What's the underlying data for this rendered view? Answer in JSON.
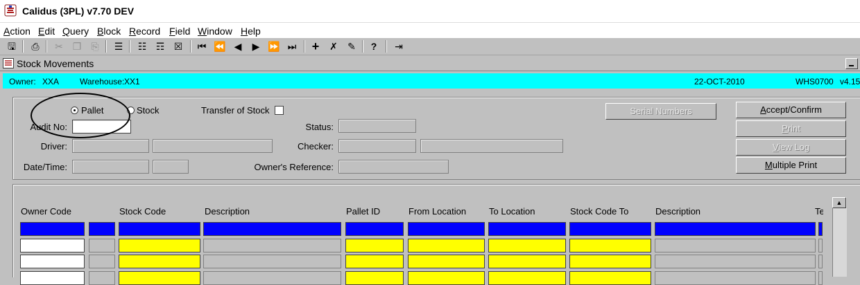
{
  "app": {
    "title": "Calidus (3PL) v7.70 DEV"
  },
  "menu": [
    {
      "label": "Action",
      "u": "A",
      "rest": "ction"
    },
    {
      "label": "Edit",
      "u": "E",
      "rest": "dit"
    },
    {
      "label": "Query",
      "u": "Q",
      "rest": "uery"
    },
    {
      "label": "Block",
      "u": "B",
      "rest": "lock"
    },
    {
      "label": "Record",
      "u": "R",
      "rest": "ecord"
    },
    {
      "label": "Field",
      "u": "F",
      "rest": "ield"
    },
    {
      "label": "Window",
      "u": "W",
      "rest": "indow"
    },
    {
      "label": "Help",
      "u": "H",
      "rest": "elp"
    }
  ],
  "window": {
    "title": "Stock Movements"
  },
  "info_bar": {
    "owner_label": "Owner:",
    "owner_value": "XXA",
    "warehouse_label": "Warehouse:",
    "warehouse_value": "XX1",
    "date": "22-OCT-2010",
    "module": "WHS0700",
    "version": "v4.15"
  },
  "form": {
    "radio_pallet": "Pallet",
    "radio_stock": "Stock",
    "radio_selected": "Pallet",
    "transfer_label": "Transfer of Stock",
    "audit_label": "Audit No:",
    "driver_label": "Driver:",
    "datetime_label": "Date/Time:",
    "status_label": "Status:",
    "checker_label": "Checker:",
    "owners_ref_label": "Owner's Reference:"
  },
  "buttons": {
    "serial_numbers": "Serial Numbers",
    "accept_confirm_u": "A",
    "accept_confirm_rest": "ccept/Confirm",
    "print_u": "P",
    "print_rest": "rint",
    "view_log_u": "V",
    "view_log_rest": "iew Log",
    "multiple_print_u": "M",
    "multiple_print_rest": "ultiple Print"
  },
  "grid": {
    "headers": [
      "Owner Code",
      "Stock Code",
      "Description",
      "Pallet ID",
      "From Location",
      "To Location",
      "Stock Code To",
      "Description",
      "Te"
    ]
  }
}
